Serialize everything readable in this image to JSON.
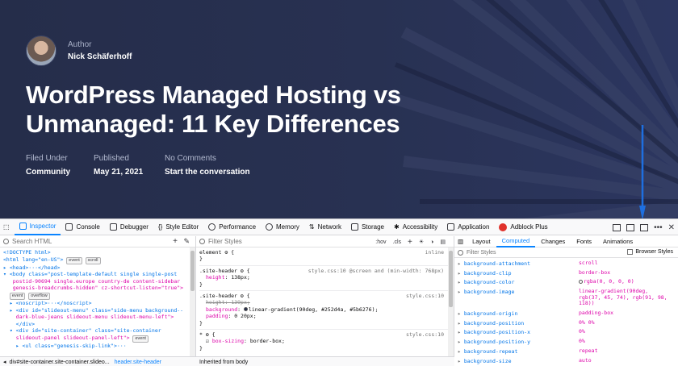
{
  "hero": {
    "author_label": "Author",
    "author_name": "Nick Schäferhoff",
    "title": "WordPress Managed Hosting vs Unmanaged: 11 Key Differences",
    "meta": [
      {
        "label": "Filed Under",
        "value": "Community"
      },
      {
        "label": "Published",
        "value": "May 21, 2021"
      },
      {
        "label": "No Comments",
        "value": "Start the conversation"
      }
    ],
    "colors": {
      "bg": "#252d4a",
      "accent": "#5b6276",
      "arrow": "#1e6fe0"
    }
  },
  "devtools": {
    "tabs": [
      {
        "label": "Inspector",
        "icon": "inspector-icon",
        "active": true
      },
      {
        "label": "Console",
        "icon": "console-icon"
      },
      {
        "label": "Debugger",
        "icon": "debugger-icon"
      },
      {
        "label": "Style Editor",
        "icon": "style-editor-icon"
      },
      {
        "label": "Performance",
        "icon": "performance-icon"
      },
      {
        "label": "Memory",
        "icon": "memory-icon"
      },
      {
        "label": "Network",
        "icon": "network-icon"
      },
      {
        "label": "Storage",
        "icon": "storage-icon"
      },
      {
        "label": "Accessibility",
        "icon": "accessibility-icon"
      },
      {
        "label": "Application",
        "icon": "application-icon"
      },
      {
        "label": "Adblock Plus",
        "icon": "adblock-icon"
      }
    ],
    "html_search_placeholder": "Search HTML",
    "rules_filter_placeholder": "Filter Styles",
    "rules_tools": {
      "hov": ":hov",
      "cls": ".cls"
    },
    "breadcrumb": {
      "path": "div#site-container.site-container.slideo...",
      "selected": "header.site-header"
    },
    "html_lines": {
      "doctype": "<!DOCTYPE html>",
      "html_open": "<html lang=\"en-US\">",
      "head": "▸ <head>···</head>",
      "body_open": "▾ <body class=\"post-template-default single single-post",
      "body_cont1": "   postid-90694 single.europe country-de content-sidebar",
      "body_cont2": "   genesis-breadcrumbs-hidden\" cz-shortcut-listen=\"true\">",
      "noscript": "  ▸ <noscript>···</noscript>",
      "slideout1": "  ▸ <div id=\"slideout-menu\" class=\"side-menu background--",
      "slideout2": "    dark-blue-jeans slideout-menu slideout-menu-left\">",
      "close_div": "    </div>",
      "site1": "  ▾ <div id=\"site-container\" class=\"site-container",
      "site2": "    slideout-panel slideout-panel-left\">",
      "skip": "    ▸ <ul class=\"genesis-skip-link\">···"
    },
    "badges": {
      "event": "event",
      "scroll": "scroll",
      "overflow": "overflow",
      "dots": "···"
    },
    "rules": [
      {
        "selector": "element",
        "source": "inline",
        "props": []
      },
      {
        "selector": ".site-header",
        "source": "style.css:10 @screen and (min-width: 768px)",
        "props": [
          {
            "k": "height",
            "v": "138px;"
          }
        ]
      },
      {
        "selector": ".site-header",
        "source": "style.css:10",
        "props": [
          {
            "k": "height",
            "v": "139px;",
            "struck": true
          },
          {
            "k": "background",
            "v": "linear-gradient(90deg, #252d4a, #5b6276);"
          },
          {
            "k": "padding",
            "v": "0 20px;"
          }
        ]
      },
      {
        "selector": "*",
        "source": "style.css:10",
        "props": [
          {
            "k": "box-sizing",
            "v": "border-box;"
          }
        ]
      }
    ],
    "inherited_label": "Inherited from body",
    "computed_tabs": [
      "Layout",
      "Computed",
      "Changes",
      "Fonts",
      "Animations"
    ],
    "computed_active": "Computed",
    "computed_filter_placeholder": "Filter Styles",
    "browser_styles_label": "Browser Styles",
    "computed": [
      {
        "n": "background-attachment",
        "v": "scroll"
      },
      {
        "n": "background-clip",
        "v": "border-box"
      },
      {
        "n": "background-color",
        "v": "rgba(0, 0, 0, 0)"
      },
      {
        "n": "background-image",
        "v": "linear-gradient(90deg, rgb(37, 45, 74), rgb(91, 98, 118))"
      },
      {
        "n": "background-origin",
        "v": "padding-box"
      },
      {
        "n": "background-position",
        "v": "0% 0%"
      },
      {
        "n": "background-position-x",
        "v": "0%"
      },
      {
        "n": "background-position-y",
        "v": "0%"
      },
      {
        "n": "background-repeat",
        "v": "repeat"
      },
      {
        "n": "background-size",
        "v": "auto"
      }
    ]
  }
}
